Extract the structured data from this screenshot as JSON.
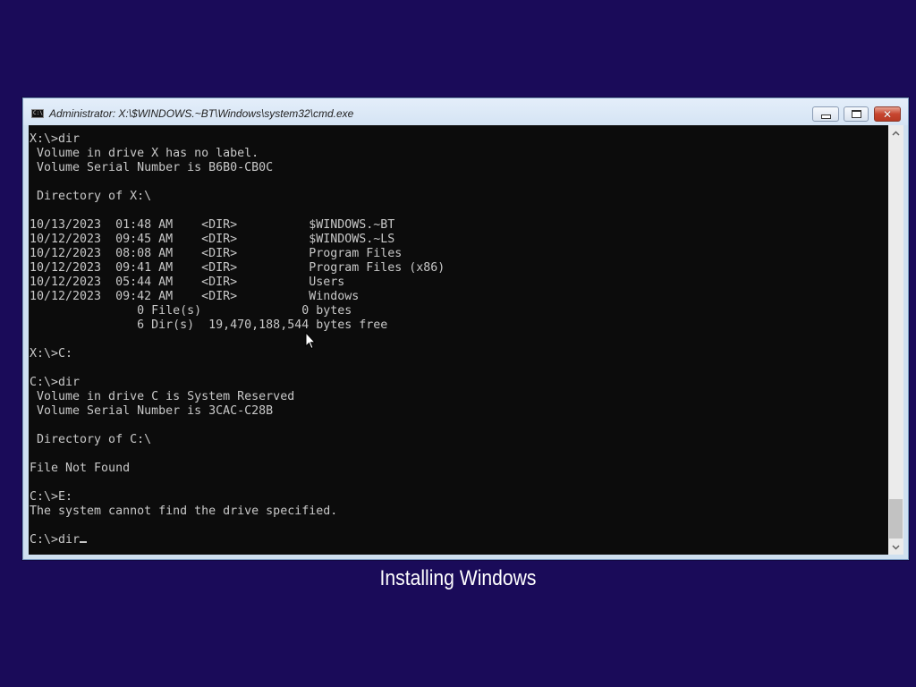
{
  "window": {
    "title": "Administrator: X:\\$WINDOWS.~BT\\Windows\\system32\\cmd.exe",
    "icon": "cmd-icon",
    "buttons": {
      "minimize": "minimize-icon",
      "maximize": "maximize-icon",
      "close": "close-icon"
    }
  },
  "console": {
    "lines": [
      "X:\\>dir",
      " Volume in drive X has no label.",
      " Volume Serial Number is B6B0-CB0C",
      "",
      " Directory of X:\\",
      "",
      "10/13/2023  01:48 AM    <DIR>          $WINDOWS.~BT",
      "10/12/2023  09:45 AM    <DIR>          $WINDOWS.~LS",
      "10/12/2023  08:08 AM    <DIR>          Program Files",
      "10/12/2023  09:41 AM    <DIR>          Program Files (x86)",
      "10/12/2023  05:44 AM    <DIR>          Users",
      "10/12/2023  09:42 AM    <DIR>          Windows",
      "               0 File(s)              0 bytes",
      "               6 Dir(s)  19,470,188,544 bytes free",
      "",
      "X:\\>C:",
      "",
      "C:\\>dir",
      " Volume in drive C is System Reserved",
      " Volume Serial Number is 3CAC-C28B",
      "",
      " Directory of C:\\",
      "",
      "File Not Found",
      "",
      "C:\\>E:",
      "The system cannot find the drive specified.",
      ""
    ],
    "prompt": "C:\\>dir",
    "text_color": "#c8c8c8",
    "background": "#0c0c0c"
  },
  "scrollbar": {
    "up_icon": "scroll-up-arrow-icon",
    "down_icon": "scroll-down-arrow-icon"
  },
  "status": {
    "caption": "Installing Windows"
  },
  "colors": {
    "desktop_background": "#1a0b59",
    "titlebar": "#d5e4f4",
    "close_button": "#c7452f"
  }
}
